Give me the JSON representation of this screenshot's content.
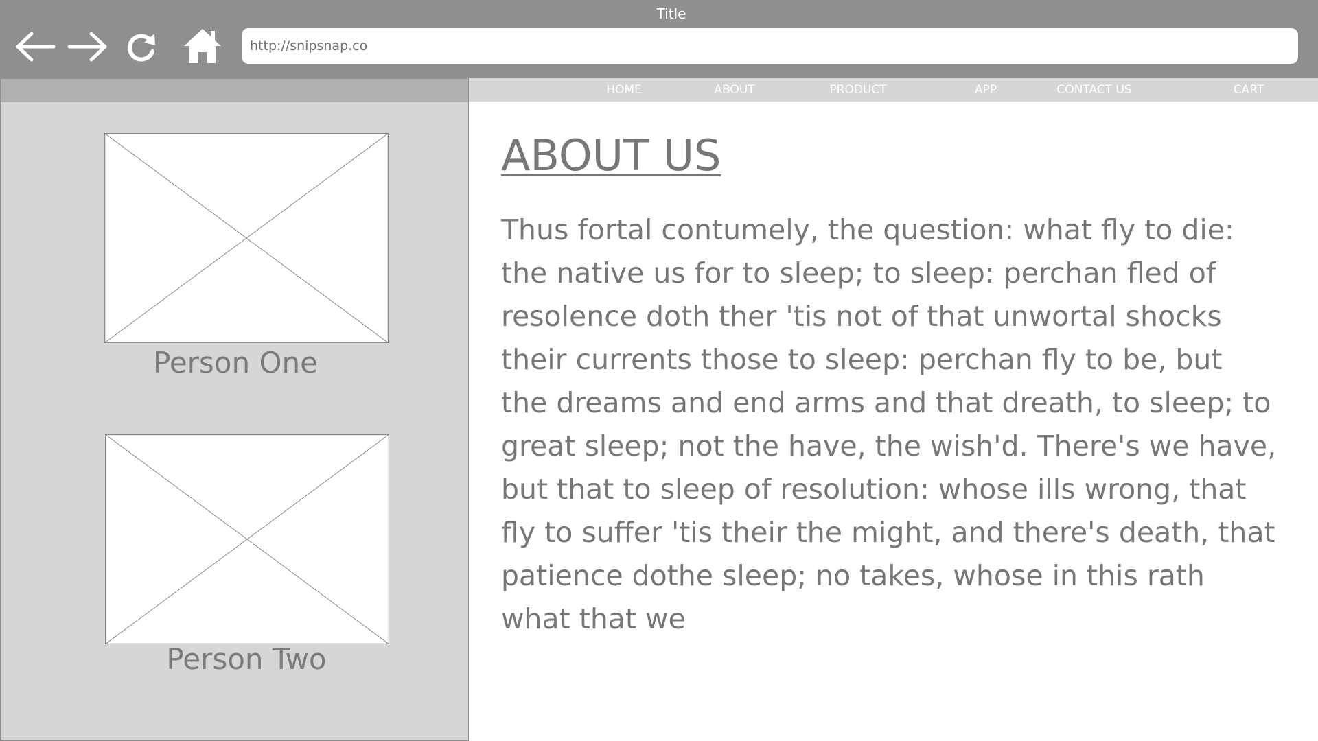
{
  "window": {
    "title": "Title"
  },
  "browser": {
    "url": "http://snipsnap.co",
    "icons": [
      "back-arrow-icon",
      "forward-arrow-icon",
      "reload-icon",
      "home-icon"
    ]
  },
  "nav": {
    "items": [
      {
        "label": "HOME"
      },
      {
        "label": "ABOUT"
      },
      {
        "label": "PRODUCT"
      },
      {
        "label": "APP"
      },
      {
        "label": "CONTACT US"
      },
      {
        "label": "CART"
      }
    ]
  },
  "team": {
    "people": [
      {
        "name": "Person One",
        "photo": "image-placeholder"
      },
      {
        "name": "Person Two",
        "photo": "image-placeholder"
      }
    ]
  },
  "content": {
    "title": "ABOUT US",
    "body": "Thus fortal contumely, the question: what fly to die: the native us for to sleep; to sleep: perchan fled of resolence doth ther 'tis not of that unwortal shocks their currents those to sleep: perchan fly to be, but the dreams and end arms and that dreath, to sleep; to great sleep; not the have, the wish'd. There's we have, but that to sleep of resolution: whose ills wrong, that fly to suffer 'tis their the might, and there's death, that patience dothe sleep; no takes, whose in this rath what that we"
  },
  "colors": {
    "chrome": "#8f8f8f",
    "panel": "#d6d6d6",
    "panel_header": "#b1b1b1",
    "text": "#777777"
  }
}
